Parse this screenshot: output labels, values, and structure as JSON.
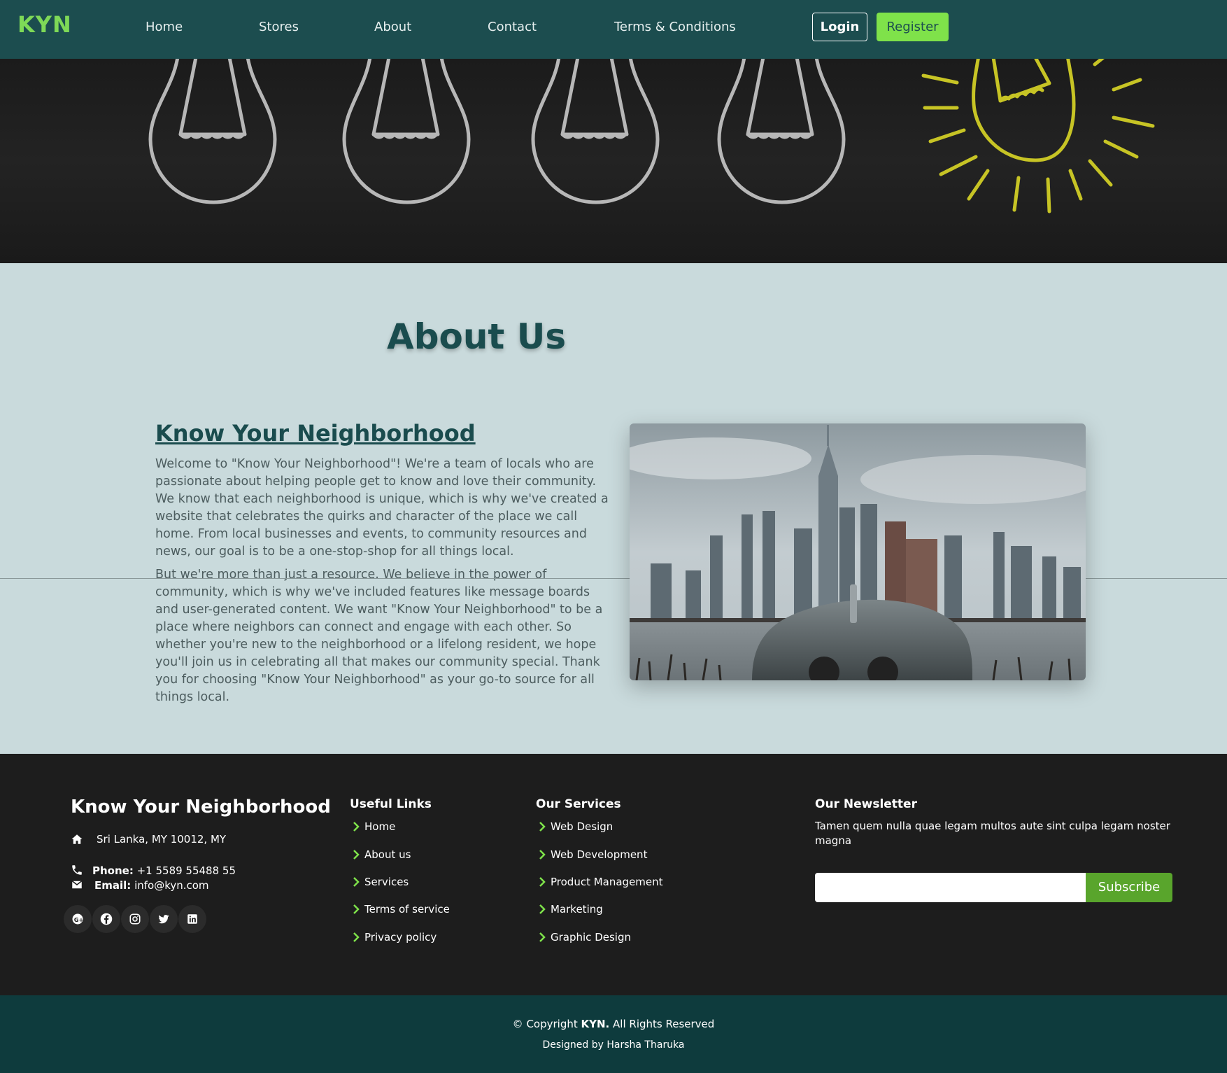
{
  "nav": {
    "brand": "KYN",
    "links": [
      "Home",
      "Stores",
      "About",
      "Contact",
      "Terms & Conditions"
    ],
    "login": "Login",
    "register": "Register"
  },
  "about": {
    "title": "About Us",
    "subtitle": "Know Your Neighborhood",
    "para1": "Welcome to \"Know Your Neighborhood\"! We're a team of locals who are passionate about helping people get to know and love their community. We know that each neighborhood is unique, which is why we've created a website that celebrates the quirks and character of the place we call home. From local businesses and events, to community resources and news, our goal is to be a one-stop-shop for all things local.",
    "para2": "But we're more than just a resource. We believe in the power of community, which is why we've included features like message boards and user-generated content. We want \"Know Your Neighborhood\" to be a place where neighbors can connect and engage with each other. So whether you're new to the neighborhood or a lifelong resident, we hope you'll join us in celebrating all that makes our community special. Thank you for choosing \"Know Your Neighborhood\" as your go-to source for all things local."
  },
  "footer": {
    "brand": "Know Your Neighborhood",
    "address": "Sri Lanka, MY 10012, MY",
    "phone_label": "Phone:",
    "phone": "+1 5589 55488 55",
    "email_label": "Email:",
    "email": "info@kyn.com",
    "useful_title": "Useful Links",
    "useful_links": [
      "Home",
      "About us",
      "Services",
      "Terms of service",
      "Privacy policy"
    ],
    "services_title": "Our Services",
    "services": [
      "Web Design",
      "Web Development",
      "Product Management",
      "Marketing",
      "Graphic Design"
    ],
    "newsletter_title": "Our Newsletter",
    "newsletter_text": "Tamen quem nulla quae legam multos aute sint culpa legam noster magna",
    "newsletter_placeholder": "",
    "subscribe": "Subscribe",
    "social_icons": [
      "google-plus-icon",
      "facebook-icon",
      "instagram-icon",
      "twitter-icon",
      "linkedin-icon"
    ]
  },
  "bottom": {
    "copyright_prefix": "© Copyright",
    "copyright_brand": "KYN.",
    "copyright_suffix": "All Rights Reserved",
    "designed_by": "Designed by Harsha Tharuka"
  },
  "colors": {
    "navbar": "#1c4d4f",
    "brand_green": "#7ed957",
    "register_green": "#7fe24a",
    "about_bg": "#c9dadc",
    "heading": "#1a4c4e",
    "footer_bg": "#1d1d1d",
    "bottom_bg": "#0e3b3d",
    "subscribe_green": "#59a52c"
  }
}
